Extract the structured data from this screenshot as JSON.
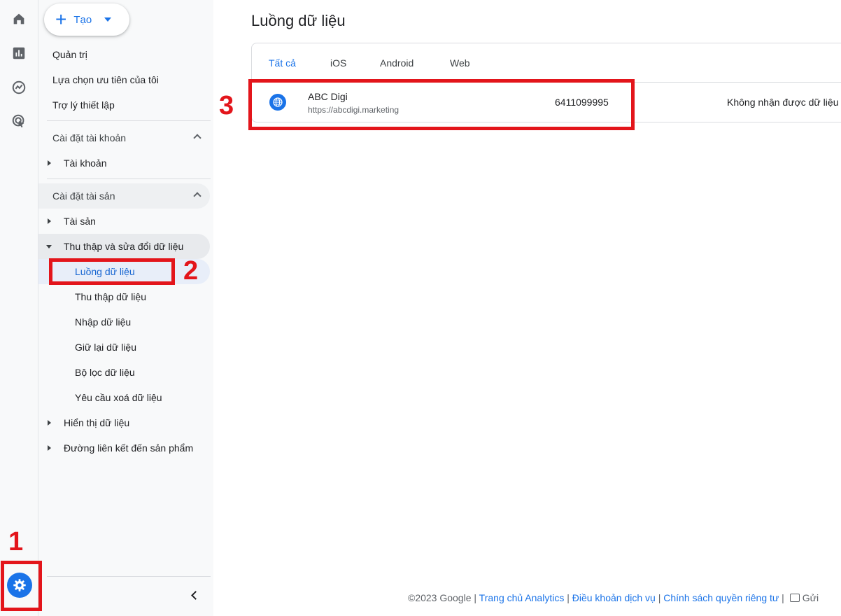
{
  "rail": {
    "icons": [
      "home-icon",
      "reports-icon",
      "explore-icon",
      "advertising-icon"
    ],
    "admin_icon": "gear-icon"
  },
  "nav": {
    "create_label": "Tạo",
    "top_items": [
      "Quản trị",
      "Lựa chọn ưu tiên của tôi",
      "Trợ lý thiết lập"
    ],
    "account_section": "Cài đặt tài khoản",
    "account_item": "Tài khoản",
    "property_section": "Cài đặt tài sản",
    "property_item": "Tài sản",
    "data_collection": "Thu thập và sửa đổi dữ liệu",
    "data_sub": [
      "Luồng dữ liệu",
      "Thu thập dữ liệu",
      "Nhập dữ liệu",
      "Giữ lại dữ liệu",
      "Bộ lọc dữ liệu",
      "Yêu cầu xoá dữ liệu"
    ],
    "data_display": "Hiển thị dữ liệu",
    "product_links": "Đường liên kết đến sản phẩm"
  },
  "main": {
    "title": "Luồng dữ liệu",
    "tabs": [
      "Tất cả",
      "iOS",
      "Android",
      "Web"
    ],
    "active_tab": "Tất cả",
    "stream": {
      "name": "ABC Digi",
      "url": "https://abcdigi.marketing",
      "id": "6411099995",
      "status": "Không nhận được dữ liệu"
    }
  },
  "annotations": [
    "1",
    "2",
    "3"
  ],
  "footer": {
    "copyright": "©2023 Google |",
    "links": [
      "Trang chủ Analytics",
      "Điều khoản dịch vụ",
      "Chính sách quyền riêng tư"
    ],
    "feedback": "Gửi"
  },
  "colors": {
    "accent": "#1a73e8",
    "annotation": "#e3151b",
    "nav_bg": "#f8f9fa"
  }
}
